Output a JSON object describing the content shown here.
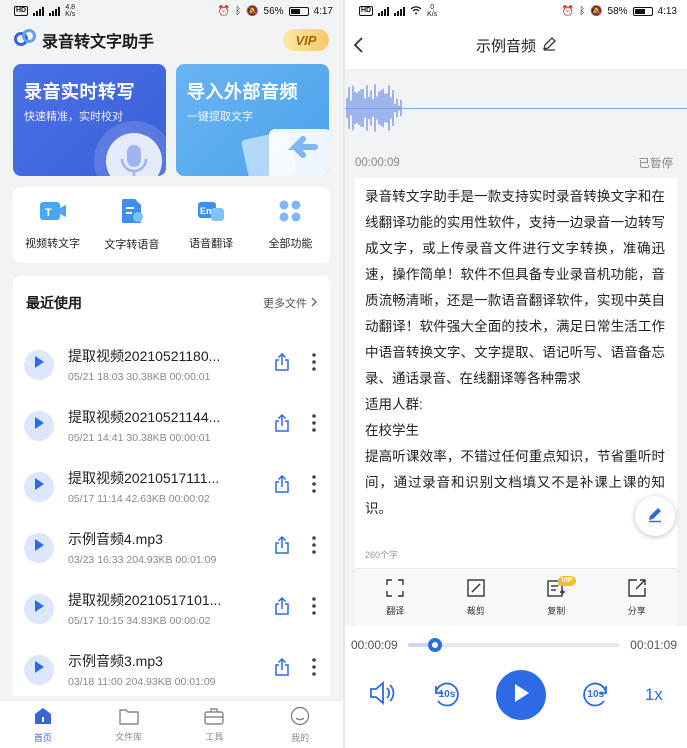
{
  "left": {
    "status": {
      "net_speed_value": "4.8",
      "net_speed_unit": "K/s",
      "battery": "56%",
      "time": "4:17"
    },
    "app_title": "录音转文字助手",
    "vip_label": "VIP",
    "hero_cards": [
      {
        "title": "录音实时转写",
        "subtitle": "快速精准，实时校对"
      },
      {
        "title": "导入外部音频",
        "subtitle": "一键提取文字"
      }
    ],
    "tools": [
      {
        "label": "视频转文字",
        "icon": "video-to-text-icon"
      },
      {
        "label": "文字转语音",
        "icon": "text-to-speech-icon"
      },
      {
        "label": "语音翻译",
        "icon": "voice-translate-icon"
      },
      {
        "label": "全部功能",
        "icon": "all-functions-icon"
      }
    ],
    "recent": {
      "title": "最近使用",
      "more_label": "更多文件",
      "items": [
        {
          "name": "提取视频20210521180...",
          "meta": "05/21 18:03  30.38KB  00:00:01"
        },
        {
          "name": "提取视频20210521144...",
          "meta": "05/21 14:41  30.38KB  00:00:01"
        },
        {
          "name": "提取视频20210517111...",
          "meta": "05/17 11:14  42.63KB  00:00:02"
        },
        {
          "name": "示例音频4.mp3",
          "meta": "03/23 16:33  204.93KB  00:01:09"
        },
        {
          "name": "提取视频20210517101...",
          "meta": "05/17 10:15  34.83KB  00:00:02"
        },
        {
          "name": "示例音频3.mp3",
          "meta": "03/18 11:00  204.93KB  00:01:09"
        }
      ]
    },
    "nav": [
      {
        "label": "首页",
        "icon": "home-icon"
      },
      {
        "label": "文件库",
        "icon": "folder-icon"
      },
      {
        "label": "工具",
        "icon": "toolbox-icon"
      },
      {
        "label": "我的",
        "icon": "profile-icon"
      }
    ]
  },
  "right": {
    "status": {
      "net_speed_value": "0",
      "net_speed_unit": "K/s",
      "battery": "58%",
      "time": "4:13"
    },
    "title": "示例音频",
    "elapsed": "00:00:09",
    "state": "已暂停",
    "paragraphs": [
      "录音转文字助手是一款支持实时录音转换文字和在线翻译功能的实用性软件，支持一边录音一边转写成文字，或上传录音文件进行文字转换，准确迅速，操作简单！软件不但具备专业录音机功能，音质流畅清晰，还是一款语音翻译软件，实现中英自动翻译！软件强大全面的技术，满足日常生活工作中语音转换文字、文字提取、语记听写、语音备忘录、通话录音、在线翻译等各种需求",
      "适用人群:",
      "在校学生",
      "提高听课效率，不错过任何重点知识，节省重听时间，通过录音和识别文档填又不是补课上课的知识。"
    ],
    "char_count": "260个字",
    "actions": [
      {
        "label": "翻译",
        "icon": "translate-icon"
      },
      {
        "label": "裁剪",
        "icon": "crop-icon"
      },
      {
        "label": "复制",
        "icon": "copy-icon",
        "badge": "VIP"
      },
      {
        "label": "分享",
        "icon": "share-icon"
      }
    ],
    "player": {
      "current": "00:00:09",
      "total": "00:01:09",
      "progress": 0.13,
      "rewind_label": "10s",
      "forward_label": "10s",
      "speed": "1x"
    }
  },
  "colors": {
    "accent": "#2d6be6",
    "brand_blue": "#3b5fd8",
    "sky_blue": "#4aa2ec",
    "vip_gold": "#f6c86a"
  }
}
